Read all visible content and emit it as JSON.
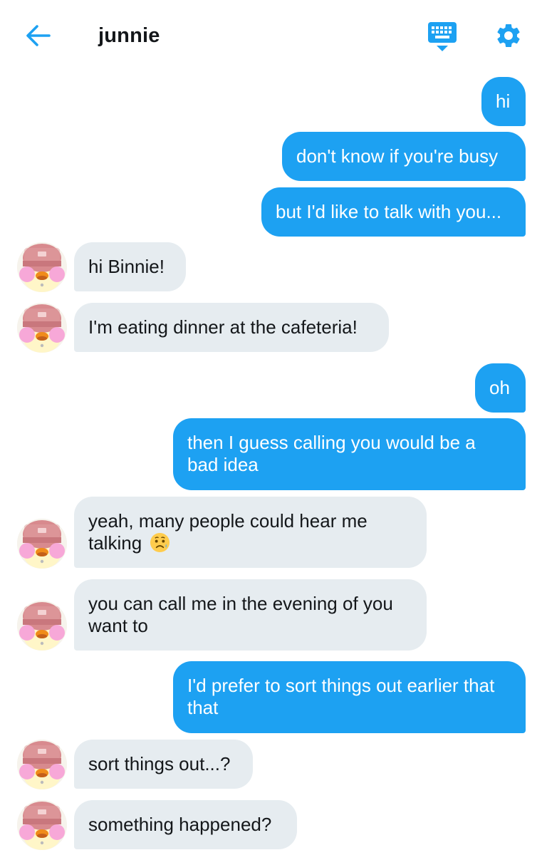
{
  "header": {
    "title": "junnie"
  },
  "colors": {
    "accent": "#1da1f2",
    "incoming_bubble": "#e6ecf0",
    "text": "#14171a"
  },
  "icons": {
    "back": "back-arrow-icon",
    "keyboard": "keyboard-icon",
    "settings": "gear-icon",
    "emoji": "sad-but-relieved-face-emoji"
  },
  "messages": [
    {
      "sender": "me",
      "text": "hi"
    },
    {
      "sender": "me",
      "text": "don't know if you're busy"
    },
    {
      "sender": "me",
      "text": "but I'd like to talk with you..."
    },
    {
      "sender": "junnie",
      "text": "hi Binnie!"
    },
    {
      "sender": "junnie",
      "text": "I'm eating dinner at the cafeteria!"
    },
    {
      "sender": "me",
      "text": "oh"
    },
    {
      "sender": "me",
      "line1": "then I guess calling you would be a",
      "line2": "bad idea"
    },
    {
      "sender": "junnie",
      "line1": "yeah, many people could hear me",
      "line2": "talking"
    },
    {
      "sender": "junnie",
      "line1": "you can call me in the evening of you",
      "line2": "want to"
    },
    {
      "sender": "me",
      "line1": "I'd prefer to sort things out earlier that",
      "line2": "that"
    },
    {
      "sender": "junnie",
      "text": "sort things out...?"
    },
    {
      "sender": "junnie",
      "text": "something happened?"
    }
  ]
}
